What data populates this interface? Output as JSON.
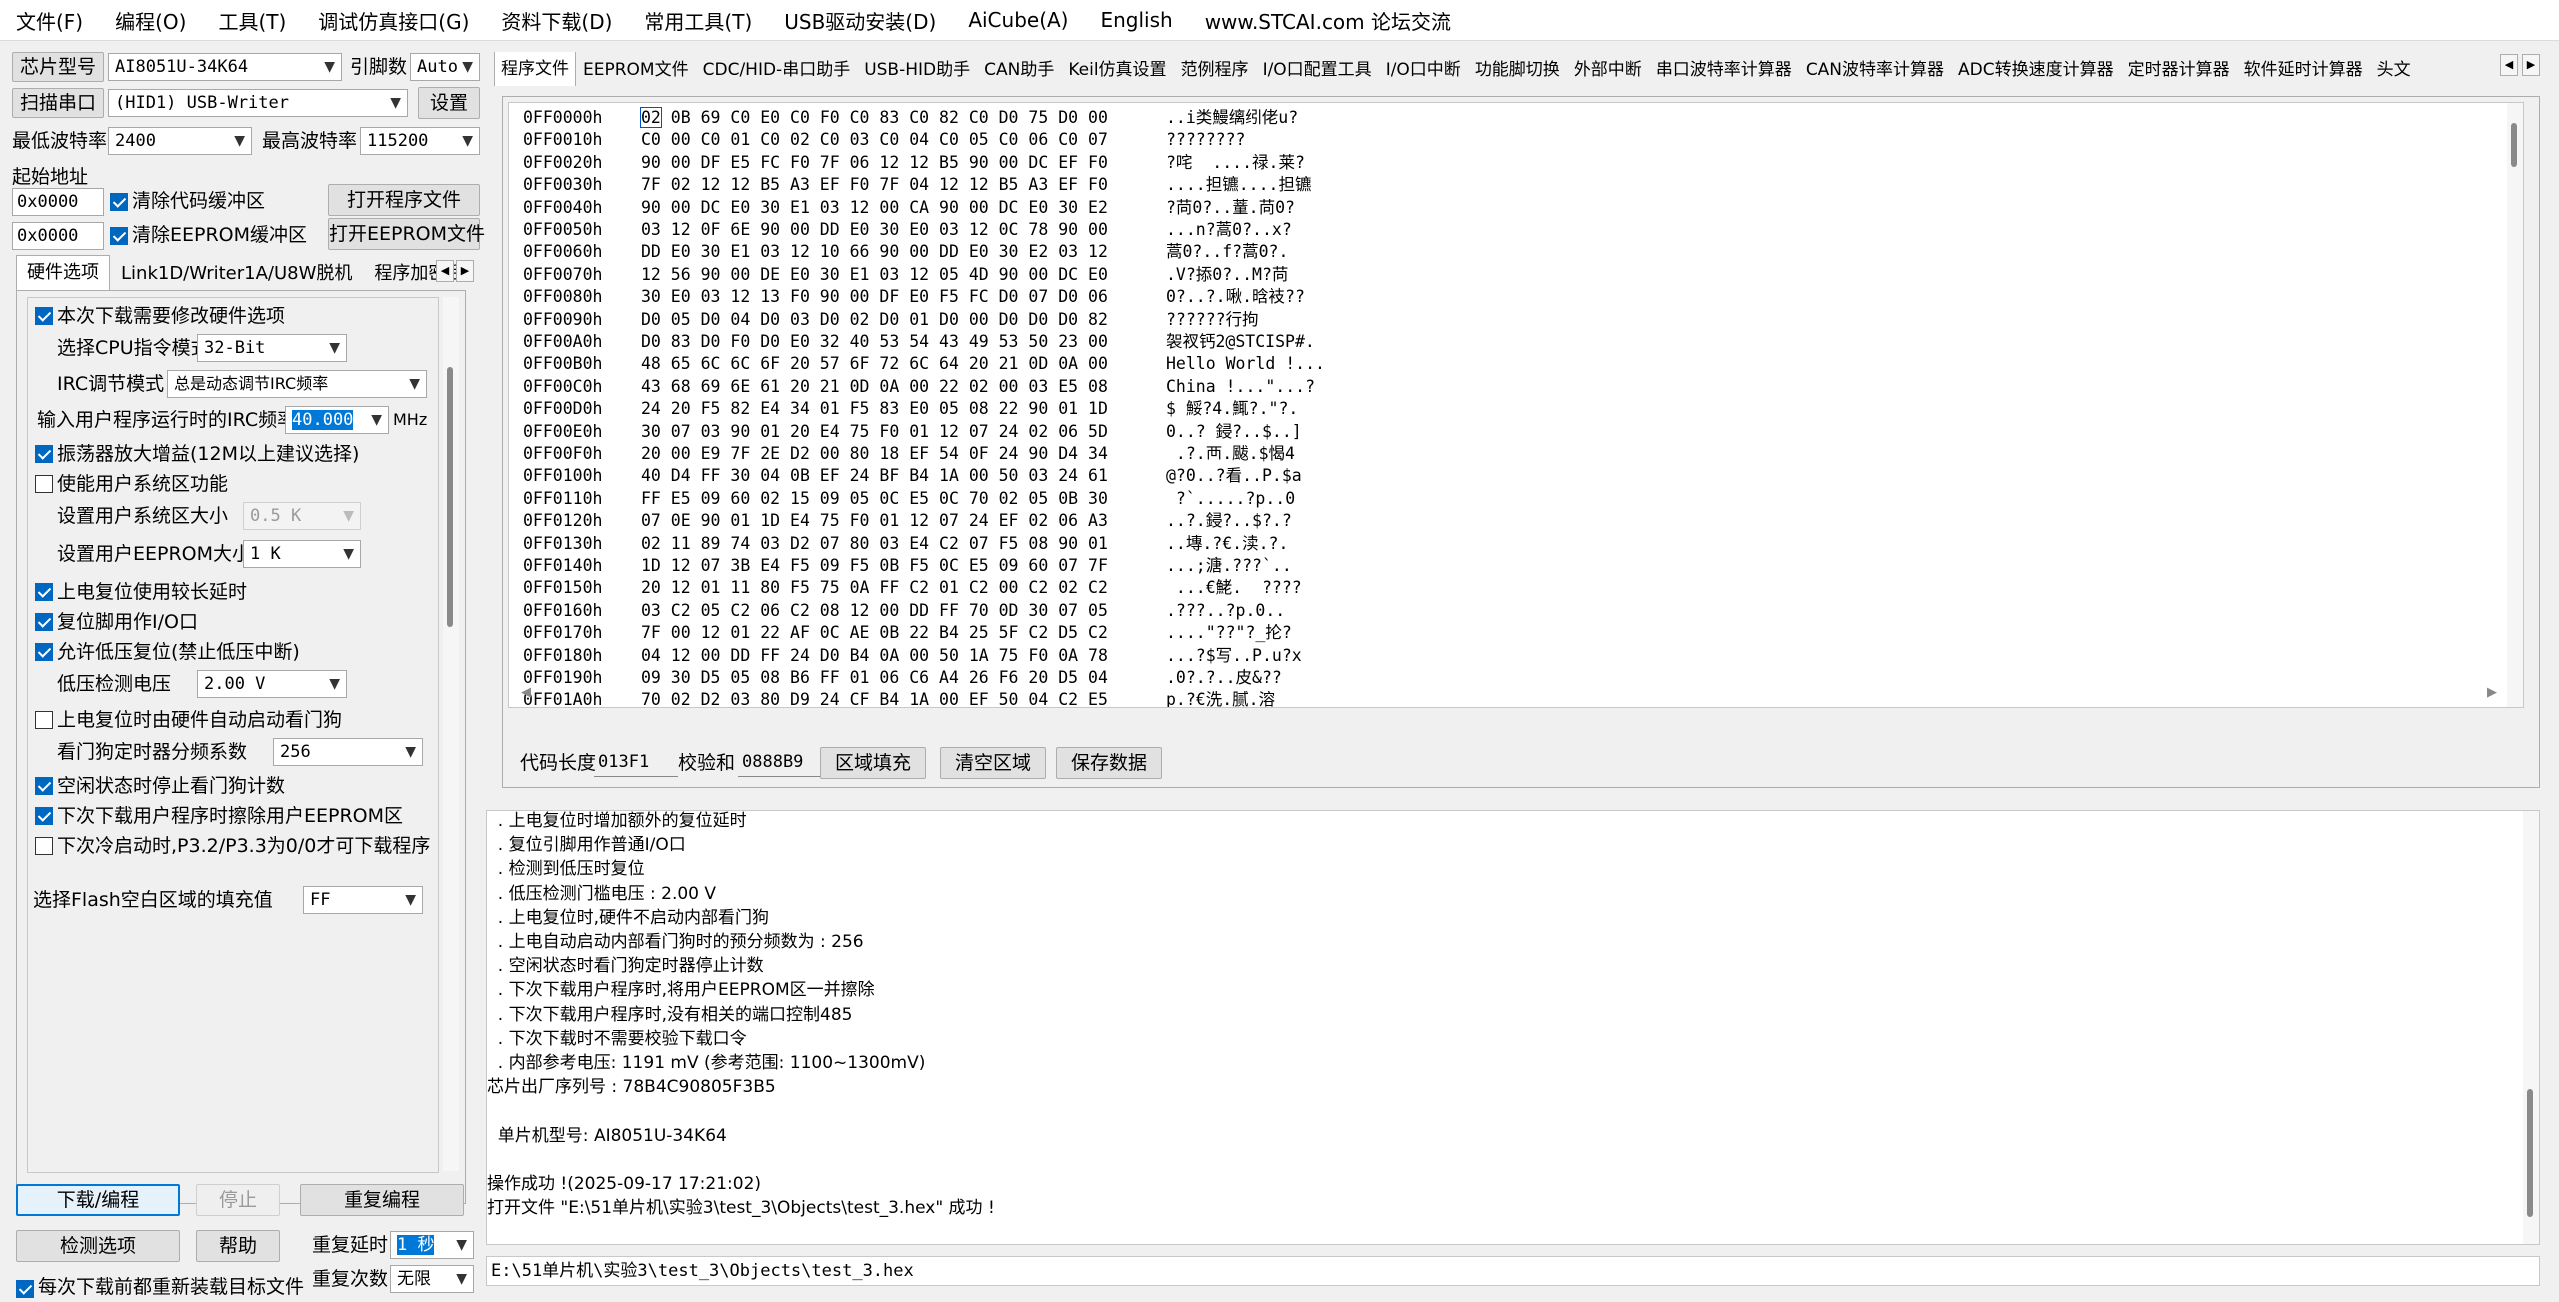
{
  "menu": [
    "文件(F)",
    "编程(O)",
    "工具(T)",
    "调试仿真接口(G)",
    "资料下载(D)",
    "常用工具(T)",
    "USB驱动安装(D)",
    "AiCube(A)",
    "English",
    "www.STCAI.com 论坛交流"
  ],
  "left": {
    "chip_type_label": "芯片型号",
    "chip_type_value": "AI8051U-34K64",
    "pin_count_label": "引脚数",
    "pin_count_value": "Auto",
    "scan_port_button": "扫描串口",
    "port_value": "(HID1) USB-Writer",
    "settings_button": "设置",
    "min_baud_label": "最低波特率",
    "min_baud_value": "2400",
    "max_baud_label": "最高波特率",
    "max_baud_value": "115200",
    "start_addr_label": "起始地址",
    "addr1_value": "0x0000",
    "clear_code_buffer": "清除代码缓冲区",
    "open_program_button": "打开程序文件",
    "addr2_value": "0x0000",
    "clear_eeprom_buffer": "清除EEPROM缓冲区",
    "open_eeprom_button": "打开EEPROM文件",
    "tabs": [
      "硬件选项",
      "Link1D/Writer1A/U8W脱机",
      "程序加密后"
    ],
    "options": {
      "modify_hw": "本次下载需要修改硬件选项",
      "cpu_mode_label": "选择CPU指令模式",
      "cpu_mode_value": "32-Bit",
      "irc_mode_label": "IRC调节模式",
      "irc_mode_value": "总是动态调节IRC频率",
      "irc_freq_label": "输入用户程序运行时的IRC频率",
      "irc_freq_value": "40.000",
      "irc_freq_unit": "MHz",
      "osc_gain": "振荡器放大增益(12M以上建议选择)",
      "user_sys_area": "使能用户系统区功能",
      "sys_area_size_label": "设置用户系统区大小",
      "sys_area_size_value": "0.5 K",
      "eeprom_size_label": "设置用户EEPROM大小",
      "eeprom_size_value": "1   K",
      "long_reset_delay": "上电复位使用较长延时",
      "reset_pin_io": "复位脚用作I/O口",
      "lvd_reset": "允许低压复位(禁止低压中断)",
      "lvd_voltage_label": "低压检测电压",
      "lvd_voltage_value": "2.00 V",
      "wdt_auto": "上电复位时由硬件自动启动看门狗",
      "wdt_div_label": "看门狗定时器分频系数",
      "wdt_div_value": "256",
      "idle_stop_wdt": "空闲状态时停止看门狗计数",
      "erase_eeprom": "下次下载用户程序时擦除用户EEPROM区",
      "cold_boot": "下次冷启动时,P3.2/P3.3为0/0才可下载程序",
      "flash_fill_label": "选择Flash空白区域的填充值",
      "flash_fill_value": "FF"
    },
    "download_button": "下载/编程",
    "stop_button": "停止",
    "reprogram_button": "重复编程",
    "check_button": "检测选项",
    "help_button": "帮助",
    "repeat_delay_label": "重复延时",
    "repeat_delay_value": "1 秒",
    "repeat_count_label": "重复次数",
    "repeat_count_value": "无限",
    "reload_each": "每次下载前都重新装载目标文件"
  },
  "main_tabs": [
    "程序文件",
    "EEPROM文件",
    "CDC/HID-串口助手",
    "USB-HID助手",
    "CAN助手",
    "Keil仿真设置",
    "范例程序",
    "I/O口配置工具",
    "I/O口中断",
    "功能脚切换",
    "外部中断",
    "串口波特率计算器",
    "CAN波特率计算器",
    "ADC转换速度计算器",
    "定时器计算器",
    "软件延时计算器",
    "头文"
  ],
  "hex": [
    {
      "addr": "0FF0000h",
      "bytes": "02 0B 69 C0 E0 C0 F0 C0 83 C0 82 C0 D0 75 D0 00",
      "ascii": "..i类鰻缡纼佬u?"
    },
    {
      "addr": "0FF0010h",
      "bytes": "C0 00 C0 01 C0 02 C0 03 C0 04 C0 05 C0 06 C0 07",
      "ascii": "????????"
    },
    {
      "addr": "0FF0020h",
      "bytes": "90 00 DF E5 FC F0 7F 06 12 12 B5 90 00 DC EF F0",
      "ascii": "?咤  ....禄.莱?"
    },
    {
      "addr": "0FF0030h",
      "bytes": "7F 02 12 12 B5 A3 EF F0 7F 04 12 12 B5 A3 EF F0",
      "ascii": "....担镳....担镳"
    },
    {
      "addr": "0FF0040h",
      "bytes": "90 00 DC E0 30 E1 03 12 00 CA 90 00 DC E0 30 E2",
      "ascii": "?苘0?..蕫.苘0?"
    },
    {
      "addr": "0FF0050h",
      "bytes": "03 12 0F 6E 90 00 DD E0 30 E0 03 12 0C 78 90 00",
      "ascii": "...n?蒿0?..x?"
    },
    {
      "addr": "0FF0060h",
      "bytes": "DD E0 30 E1 03 12 10 66 90 00 DD E0 30 E2 03 12",
      "ascii": "蒿0?..f?蒿0?."
    },
    {
      "addr": "0FF0070h",
      "bytes": "12 56 90 00 DE E0 30 E1 03 12 05 4D 90 00 DC E0",
      "ascii": ".V?掭0?..M?苘"
    },
    {
      "addr": "0FF0080h",
      "bytes": "30 E0 03 12 13 F0 90 00 DF E0 F5 FC D0 07 D0 06",
      "ascii": "0?..?.啾.晗衼??"
    },
    {
      "addr": "0FF0090h",
      "bytes": "D0 05 D0 04 D0 03 D0 02 D0 01 D0 00 D0 D0 D0 82",
      "ascii": "??????行拘"
    },
    {
      "addr": "0FF00A0h",
      "bytes": "D0 83 D0 F0 D0 E0 32 40 53 54 43 49 53 50 23 00",
      "ascii": "袈衩钙2@STCISP#."
    },
    {
      "addr": "0FF00B0h",
      "bytes": "48 65 6C 6C 6F 20 57 6F 72 6C 64 20 21 0D 0A 00",
      "ascii": "Hello World !..."
    },
    {
      "addr": "0FF00C0h",
      "bytes": "43 68 69 6E 61 20 21 0D 0A 00 22 02 00 03 E5 08",
      "ascii": "China !...\"...?"
    },
    {
      "addr": "0FF00D0h",
      "bytes": "24 20 F5 82 E4 34 01 F5 83 E0 05 08 22 90 01 1D",
      "ascii": "$ 鮾?4.鮿?.\"?."
    },
    {
      "addr": "0FF00E0h",
      "bytes": "30 07 03 90 01 20 E4 75 F0 01 12 07 24 02 06 5D",
      "ascii": "0..? 鋟?..$..]"
    },
    {
      "addr": "0FF00F0h",
      "bytes": "20 00 E9 7F 2E D2 00 80 18 EF 54 0F 24 90 D4 34",
      "ascii": " .?.襾.颰.$愒4"
    },
    {
      "addr": "0FF0100h",
      "bytes": "40 D4 FF 30 04 0B EF 24 BF B4 1A 00 50 03 24 61",
      "ascii": "@?0..?看..P.$a"
    },
    {
      "addr": "0FF0110h",
      "bytes": "FF E5 09 60 02 15 09 05 0C E5 0C 70 02 05 0B 30",
      "ascii": " ?`.....?p..0"
    },
    {
      "addr": "0FF0120h",
      "bytes": "07 0E 90 01 1D E4 75 F0 01 12 07 24 EF 02 06 A3",
      "ascii": "..?.鋟?..$?.?"
    },
    {
      "addr": "0FF0130h",
      "bytes": "02 11 89 74 03 D2 07 80 03 E4 C2 07 F5 08 90 01",
      "ascii": "..塼.?€.渎.?."
    },
    {
      "addr": "0FF0140h",
      "bytes": "1D 12 07 3B E4 F5 09 F5 0B F5 0C E5 09 60 07 7F",
      "ascii": "...;溏.???`.."
    },
    {
      "addr": "0FF0150h",
      "bytes": "20 12 01 11 80 F5 75 0A FF C2 01 C2 00 C2 02 C2",
      "ascii": " ...€鮱.  ????"
    },
    {
      "addr": "0FF0160h",
      "bytes": "03 C2 05 C2 06 C2 08 12 00 DD FF 70 0D 30 07 05",
      "ascii": ".???..?p.0.."
    },
    {
      "addr": "0FF0170h",
      "bytes": "7F 00 12 01 22 AF 0C AE 0B 22 B4 25 5F C2 D5 C2",
      "ascii": "....\"??\"?_抡?"
    },
    {
      "addr": "0FF0180h",
      "bytes": "04 12 00 DD FF 24 D0 B4 0A 00 50 1A 75 F0 0A 78",
      "ascii": "...?$写..P.u?x"
    },
    {
      "addr": "0FF0190h",
      "bytes": "09 30 D5 05 08 B6 FF 01 06 C6 A4 26 F6 20 D5 04",
      "ascii": ".0?.?..皮&??"
    },
    {
      "addr": "0FF01A0h",
      "bytes": "70 02 D2 03 80 D9 24 CF B4 1A 00 EF 50 04 C2 E5",
      "ascii": "p.?€洗.腻.溶"
    }
  ],
  "bottom": {
    "code_len_label": "代码长度",
    "code_len_value": "013F1",
    "checksum_label": "校验和",
    "checksum_value": "0888B9",
    "fill_button": "区域填充",
    "clear_button": "清空区域",
    "save_button": "保存数据"
  },
  "log": [
    "  . 上电复位时增加额外的复位延时",
    "  . 复位引脚用作普通I/O口",
    "  . 检测到低压时复位",
    "  . 低压检测门槛电压 : 2.00 V",
    "  . 上电复位时,硬件不启动内部看门狗",
    "  . 上电自动启动内部看门狗时的预分频数为 : 256",
    "  . 空闲状态时看门狗定时器停止计数",
    "  . 下次下载用户程序时,将用户EEPROM区一并擦除",
    "  . 下次下载用户程序时,没有相关的端口控制485",
    "  . 下次下载时不需要校验下载口令",
    "  . 内部参考电压: 1191 mV (参考范围: 1100~1300mV)",
    "芯片出厂序列号 : 78B4C90805F3B5",
    "",
    "  单片机型号: AI8051U-34K64",
    "",
    "操作成功 !(2025-09-17 17:21:02)",
    "打开文件 \"E:\\51单片机\\实验3\\test_3\\Objects\\test_3.hex\" 成功 !"
  ],
  "status_path": "E:\\51单片机\\实验3\\test_3\\Objects\\test_3.hex"
}
